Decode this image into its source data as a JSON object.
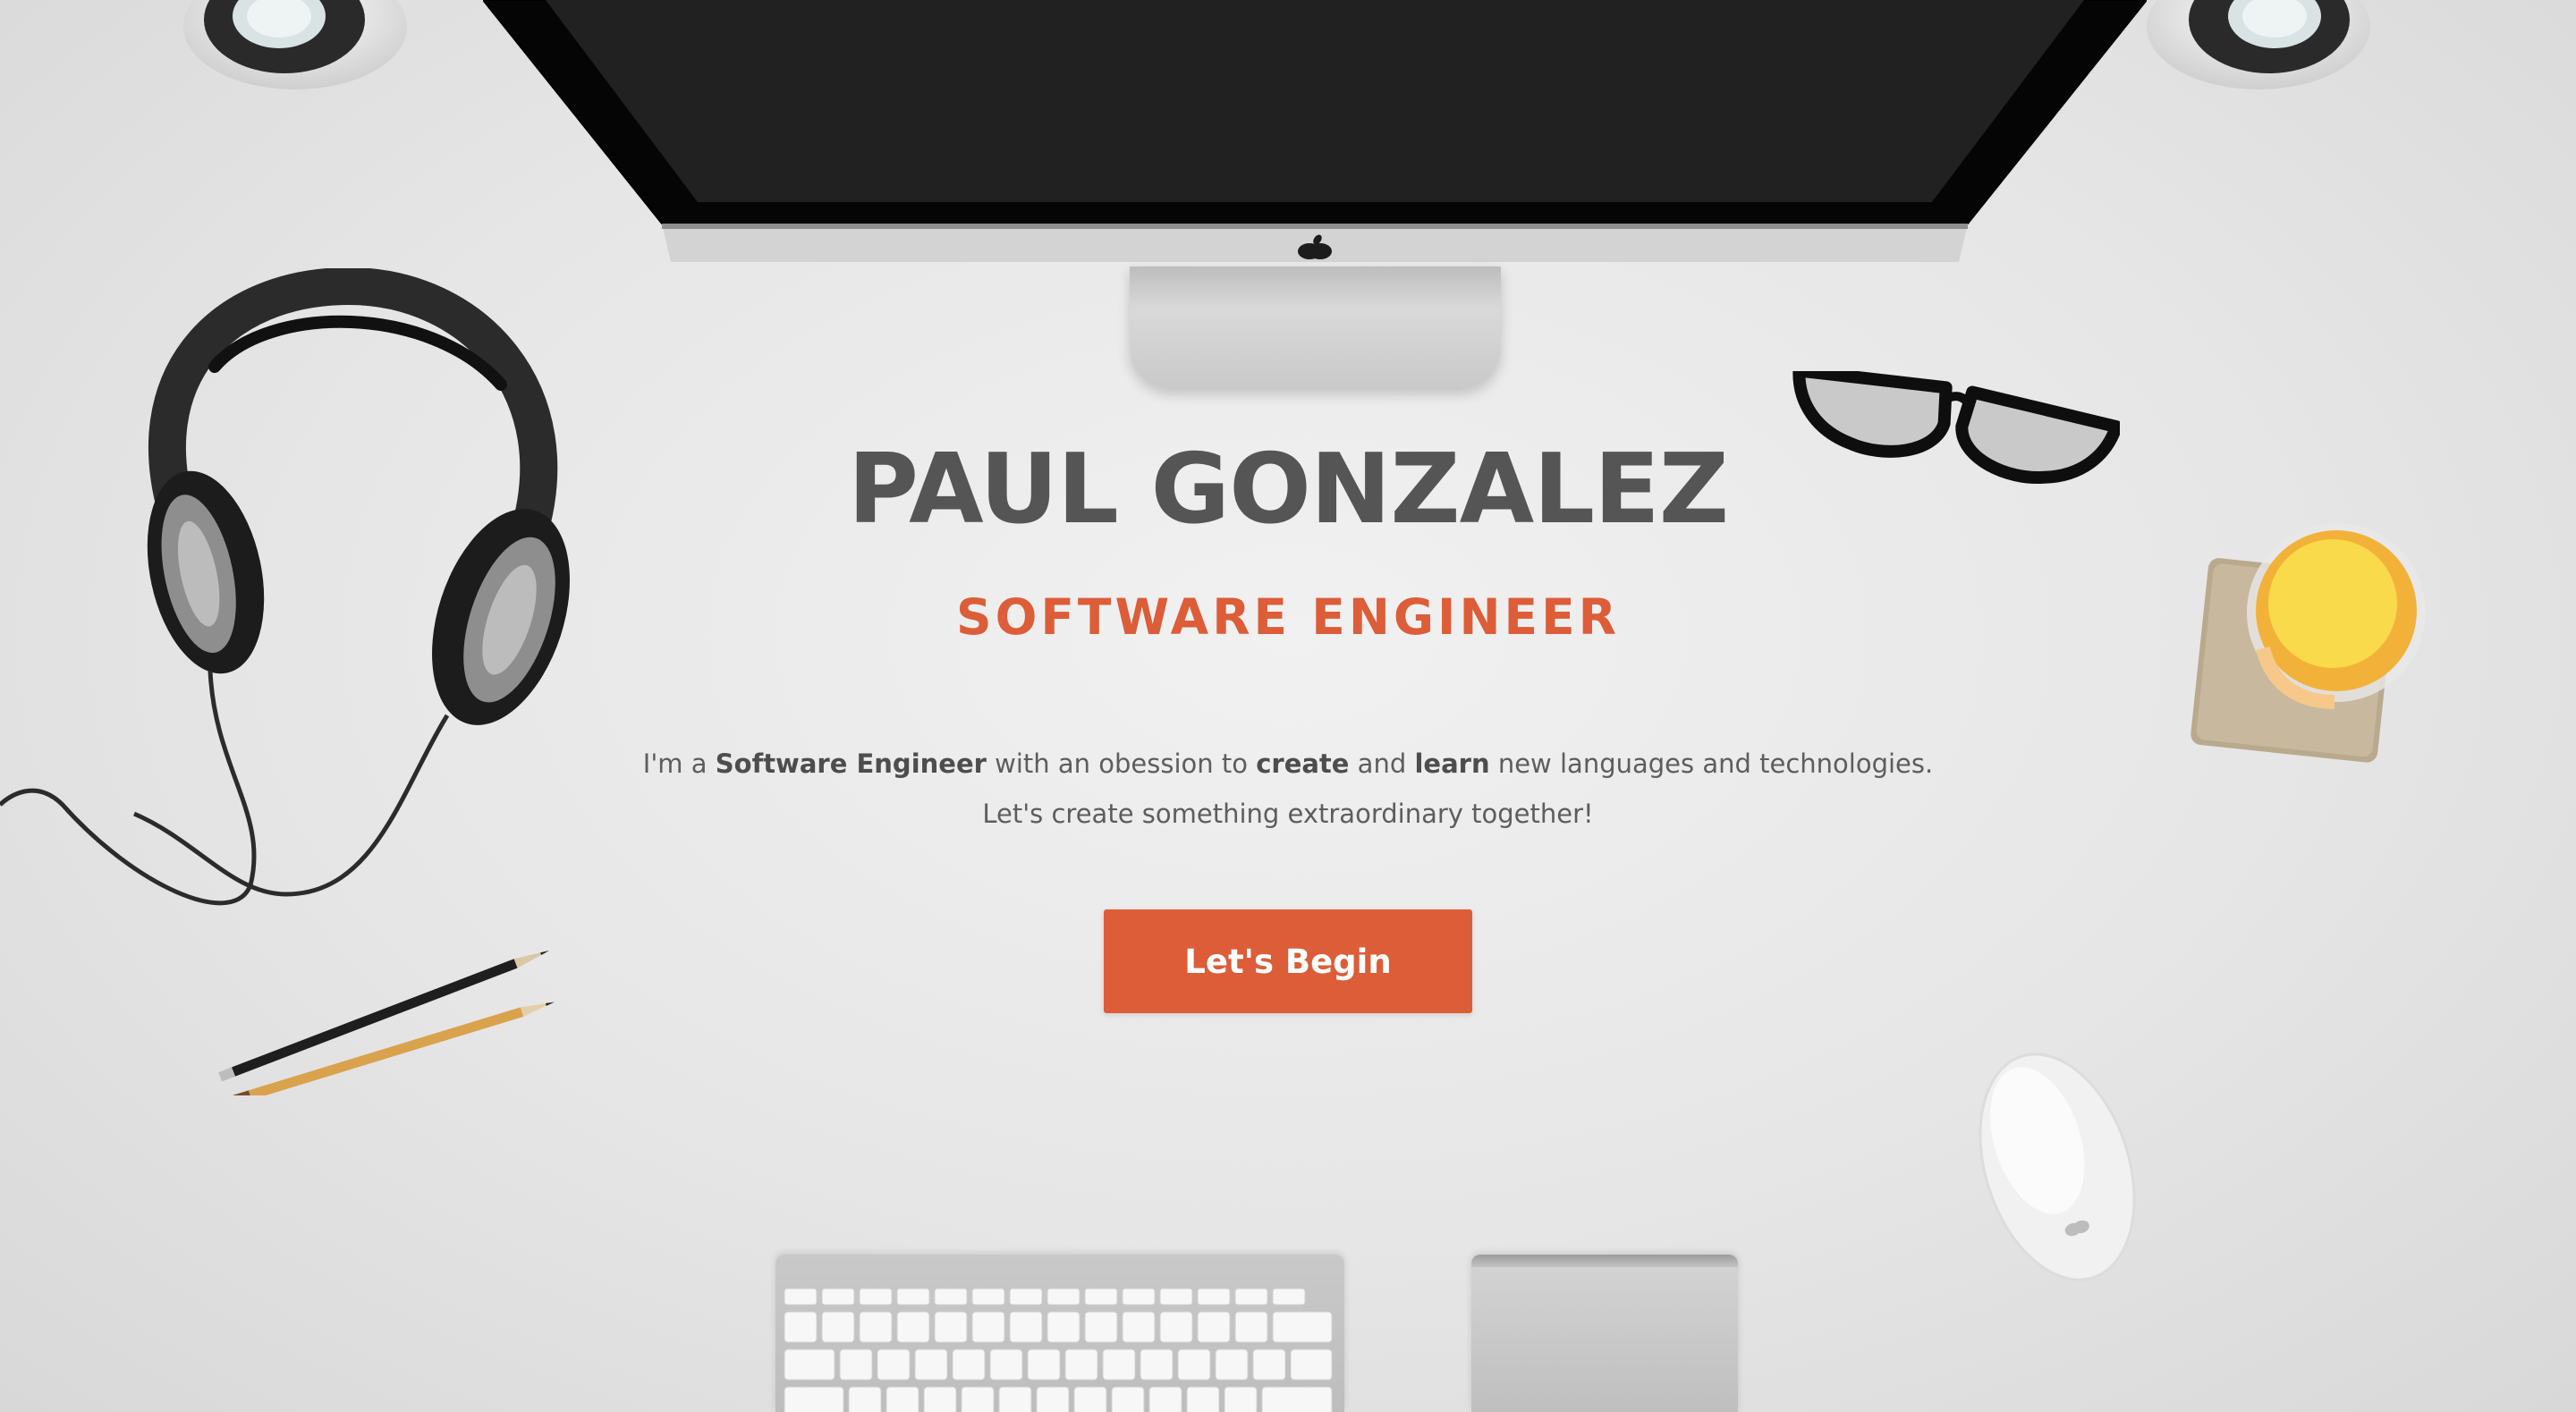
{
  "hero": {
    "name": "PAUL GONZALEZ",
    "role": "SOFTWARE ENGINEER",
    "bio_line1": {
      "t1": "I'm a ",
      "b1": "Software Engineer",
      "t2": " with an obession to ",
      "b2": "create",
      "t3": " and ",
      "b3": "learn",
      "t4": " new languages and technologies."
    },
    "bio_line2": "Let's create something extraordinary together!",
    "cta_label": "Let's Begin"
  },
  "colors": {
    "accent": "#dc5d38",
    "heading": "#555555",
    "body_text": "#5d5d5d",
    "background": "#e6e6e6"
  },
  "icons": {
    "brand_logo": "apple-logo-icon"
  }
}
